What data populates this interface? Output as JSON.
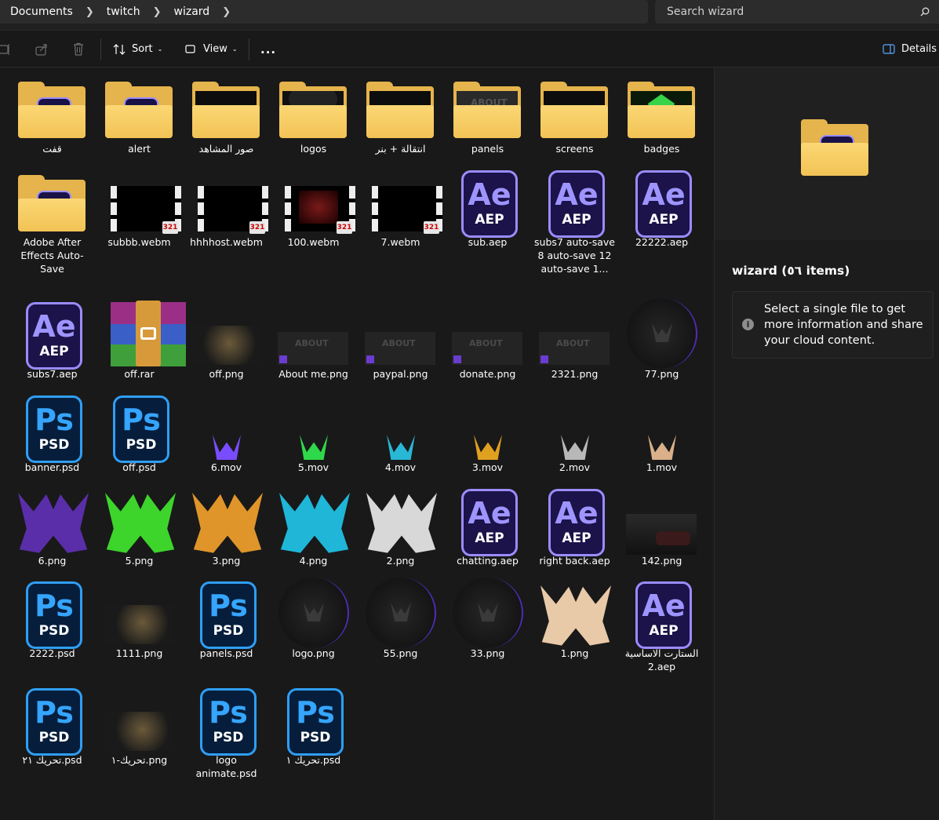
{
  "breadcrumb": [
    "Documents",
    "twitch",
    "wizard"
  ],
  "search_placeholder": "Search wizard",
  "toolbar": {
    "sort": "Sort",
    "view": "View",
    "more": "...",
    "details": "Details"
  },
  "details_pane": {
    "title": "wizard (٥٦ items)",
    "info": "Select a single file to get more information and share your cloud content."
  },
  "items": [
    {
      "name": "قفت",
      "kind": "folder-ae"
    },
    {
      "name": "alert",
      "kind": "folder-ae"
    },
    {
      "name": "صور المشاهد",
      "kind": "folder-dark"
    },
    {
      "name": "logos",
      "kind": "folder-logo"
    },
    {
      "name": "انتقالة + بنر",
      "kind": "folder-dark"
    },
    {
      "name": "panels",
      "kind": "folder-panel"
    },
    {
      "name": "screens",
      "kind": "folder-dark"
    },
    {
      "name": "badges",
      "kind": "folder-green"
    },
    {
      "name": "Adobe After Effects Auto-Save",
      "kind": "folder-ae"
    },
    {
      "name": "subbb.webm",
      "kind": "video"
    },
    {
      "name": "hhhhost.webm",
      "kind": "video"
    },
    {
      "name": "100.webm",
      "kind": "video-red"
    },
    {
      "name": "7.webm",
      "kind": "video"
    },
    {
      "name": "sub.aep",
      "kind": "aep"
    },
    {
      "name": "subs7 auto-save 8 auto-save 12 auto-save 1...",
      "kind": "aep"
    },
    {
      "name": "22222.aep",
      "kind": "aep"
    },
    {
      "name": "subs7.aep",
      "kind": "aep"
    },
    {
      "name": "off.rar",
      "kind": "rar"
    },
    {
      "name": "off.png",
      "kind": "img-room"
    },
    {
      "name": "About me.png",
      "kind": "img-panel"
    },
    {
      "name": "paypal.png",
      "kind": "img-panel"
    },
    {
      "name": "donate.png",
      "kind": "img-panel"
    },
    {
      "name": "2321.png",
      "kind": "img-panel"
    },
    {
      "name": "77.png",
      "kind": "img-circle"
    },
    {
      "name": "banner.psd",
      "kind": "psd"
    },
    {
      "name": "off.psd",
      "kind": "psd"
    },
    {
      "name": "6.mov",
      "kind": "glyph",
      "color": "#7a4cff"
    },
    {
      "name": "5.mov",
      "kind": "glyph",
      "color": "#2fd84a"
    },
    {
      "name": "4.mov",
      "kind": "glyph",
      "color": "#29b7d6"
    },
    {
      "name": "3.mov",
      "kind": "glyph",
      "color": "#e0a020"
    },
    {
      "name": "2.mov",
      "kind": "glyph",
      "color": "#b8b8b8"
    },
    {
      "name": "1.mov",
      "kind": "glyph",
      "color": "#d9b08a"
    },
    {
      "name": "6.png",
      "kind": "wlogo",
      "color": "#5a2ea8"
    },
    {
      "name": "5.png",
      "kind": "wlogo",
      "color": "#3dd42c"
    },
    {
      "name": "3.png",
      "kind": "wlogo",
      "color": "#e0952a"
    },
    {
      "name": "4.png",
      "kind": "wlogo",
      "color": "#1fb6d8"
    },
    {
      "name": "2.png",
      "kind": "wlogo",
      "color": "#d8d8d8"
    },
    {
      "name": "chatting.aep",
      "kind": "aep"
    },
    {
      "name": "right back.aep",
      "kind": "aep"
    },
    {
      "name": "142.png",
      "kind": "img-car"
    },
    {
      "name": "2222.psd",
      "kind": "psd"
    },
    {
      "name": "1111.png",
      "kind": "img-room"
    },
    {
      "name": "panels.psd",
      "kind": "psd"
    },
    {
      "name": "logo.png",
      "kind": "img-circle"
    },
    {
      "name": "55.png",
      "kind": "img-circle"
    },
    {
      "name": "33.png",
      "kind": "img-circle"
    },
    {
      "name": "1.png",
      "kind": "wlogo",
      "color": "#e8c9a8"
    },
    {
      "name": "الستارت الاساسية 2.aep",
      "kind": "aep"
    },
    {
      "name": "تحريك ٢١.psd",
      "kind": "psd"
    },
    {
      "name": "تحريك-١.png",
      "kind": "img-room"
    },
    {
      "name": "logo animate.psd",
      "kind": "psd"
    },
    {
      "name": "تحريك ١.psd",
      "kind": "psd"
    }
  ]
}
